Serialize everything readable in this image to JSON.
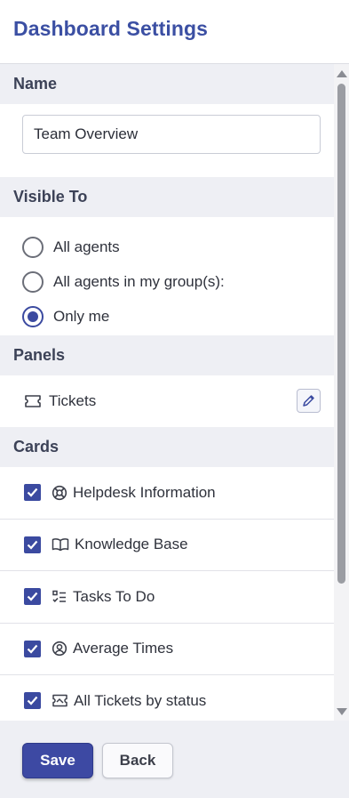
{
  "header": {
    "title": "Dashboard Settings"
  },
  "sections": {
    "name": {
      "title": "Name",
      "input_value": "Team Overview"
    },
    "visible_to": {
      "title": "Visible To",
      "options": [
        {
          "label": "All agents",
          "checked": false
        },
        {
          "label": "All agents in my group(s):",
          "checked": false
        },
        {
          "label": "Only me",
          "checked": true
        }
      ]
    },
    "panels": {
      "title": "Panels",
      "items": [
        {
          "label": "Tickets",
          "icon": "ticket-icon"
        }
      ]
    },
    "cards": {
      "title": "Cards",
      "items": [
        {
          "label": "Helpdesk Information",
          "icon": "lifebuoy-icon",
          "checked": true
        },
        {
          "label": "Knowledge Base",
          "icon": "book-icon",
          "checked": true
        },
        {
          "label": "Tasks To Do",
          "icon": "checklist-icon",
          "checked": true
        },
        {
          "label": "Average Times",
          "icon": "user-circle-icon",
          "checked": true
        },
        {
          "label": "All Tickets by status",
          "icon": "inbox-ticket-icon",
          "checked": true
        }
      ]
    }
  },
  "footer": {
    "save_label": "Save",
    "back_label": "Back"
  },
  "colors": {
    "accent": "#3b4aa0",
    "title": "#3b4fa3",
    "section_bg": "#eeeff4"
  }
}
